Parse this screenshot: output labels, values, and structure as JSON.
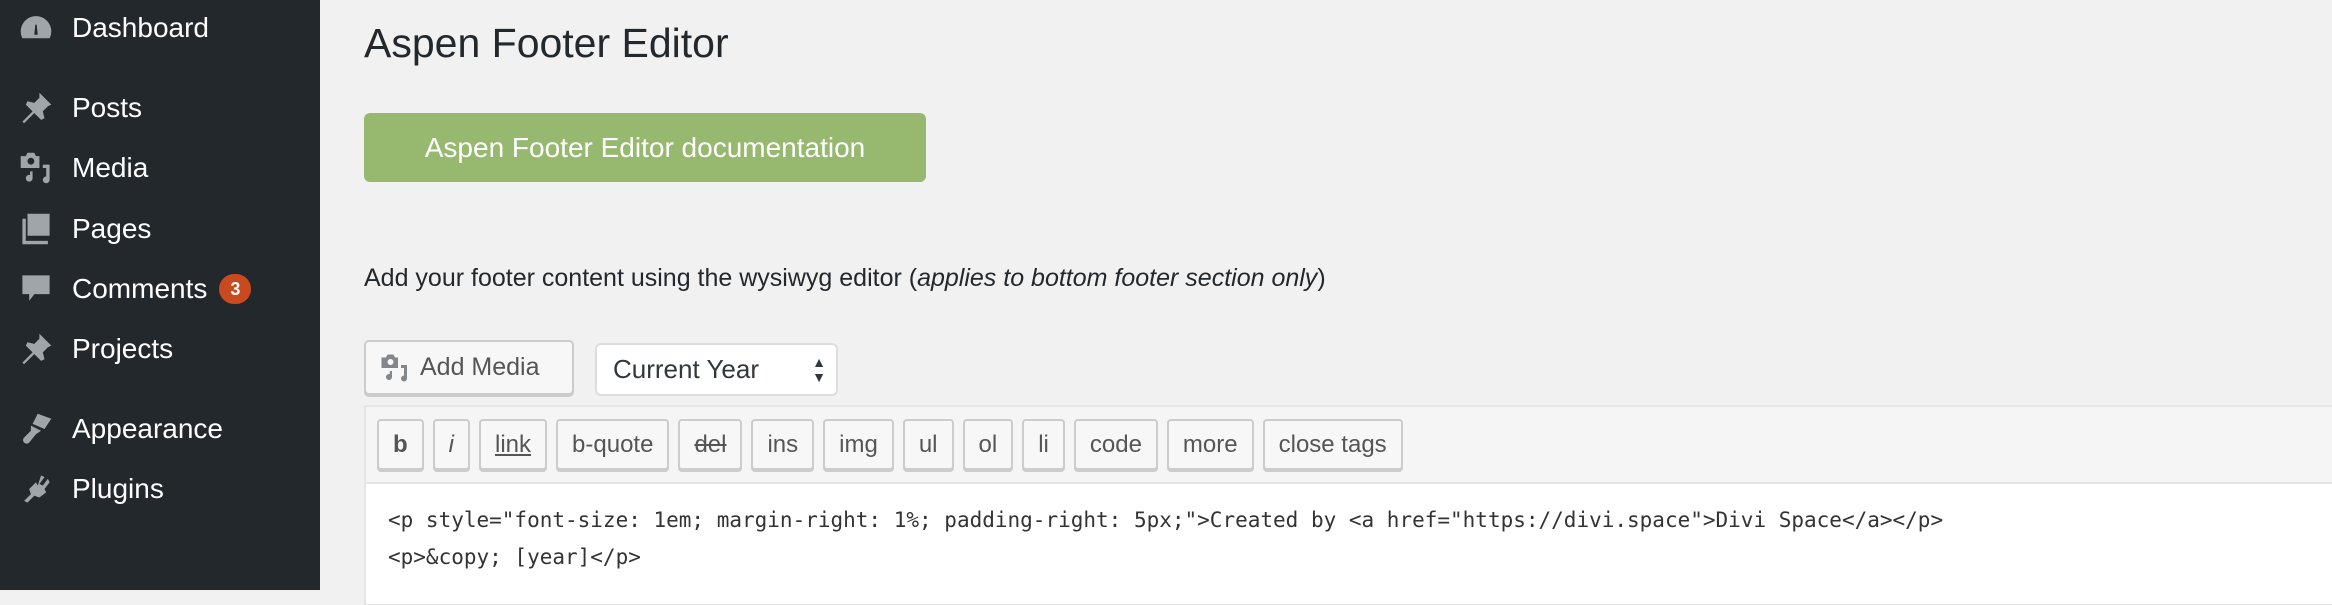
{
  "sidebar": {
    "items": [
      {
        "label": "Dashboard",
        "icon": "dashboard-icon"
      },
      {
        "label": "Posts",
        "icon": "pin-icon"
      },
      {
        "label": "Media",
        "icon": "media-icon"
      },
      {
        "label": "Pages",
        "icon": "pages-icon"
      },
      {
        "label": "Comments",
        "icon": "comment-icon",
        "badge": "3"
      },
      {
        "label": "Projects",
        "icon": "pin-icon"
      },
      {
        "label": "Appearance",
        "icon": "brush-icon"
      },
      {
        "label": "Plugins",
        "icon": "plugin-icon"
      }
    ]
  },
  "page": {
    "title": "Aspen Footer Editor",
    "doc_button": "Aspen Footer Editor documentation",
    "description_prefix": "Add your footer content using the wysiwyg editor (",
    "description_em": "applies to bottom footer section only",
    "description_suffix": ")",
    "add_media": "Add Media",
    "select_value": "Current Year",
    "toolbar": [
      "b",
      "i",
      "link",
      "b-quote",
      "del",
      "ins",
      "img",
      "ul",
      "ol",
      "li",
      "code",
      "more",
      "close tags"
    ],
    "code_lines": [
      "<p style=\"font-size: 1em; margin-right: 1%; padding-right: 5px;\">Created by <a href=\"https://divi.space\">Divi Space</a></p>",
      "<p>&copy; [year]</p>"
    ]
  },
  "colors": {
    "sidebar": "#23282d",
    "accent_button": "#97b86f",
    "badge": "#ca4a1f"
  }
}
